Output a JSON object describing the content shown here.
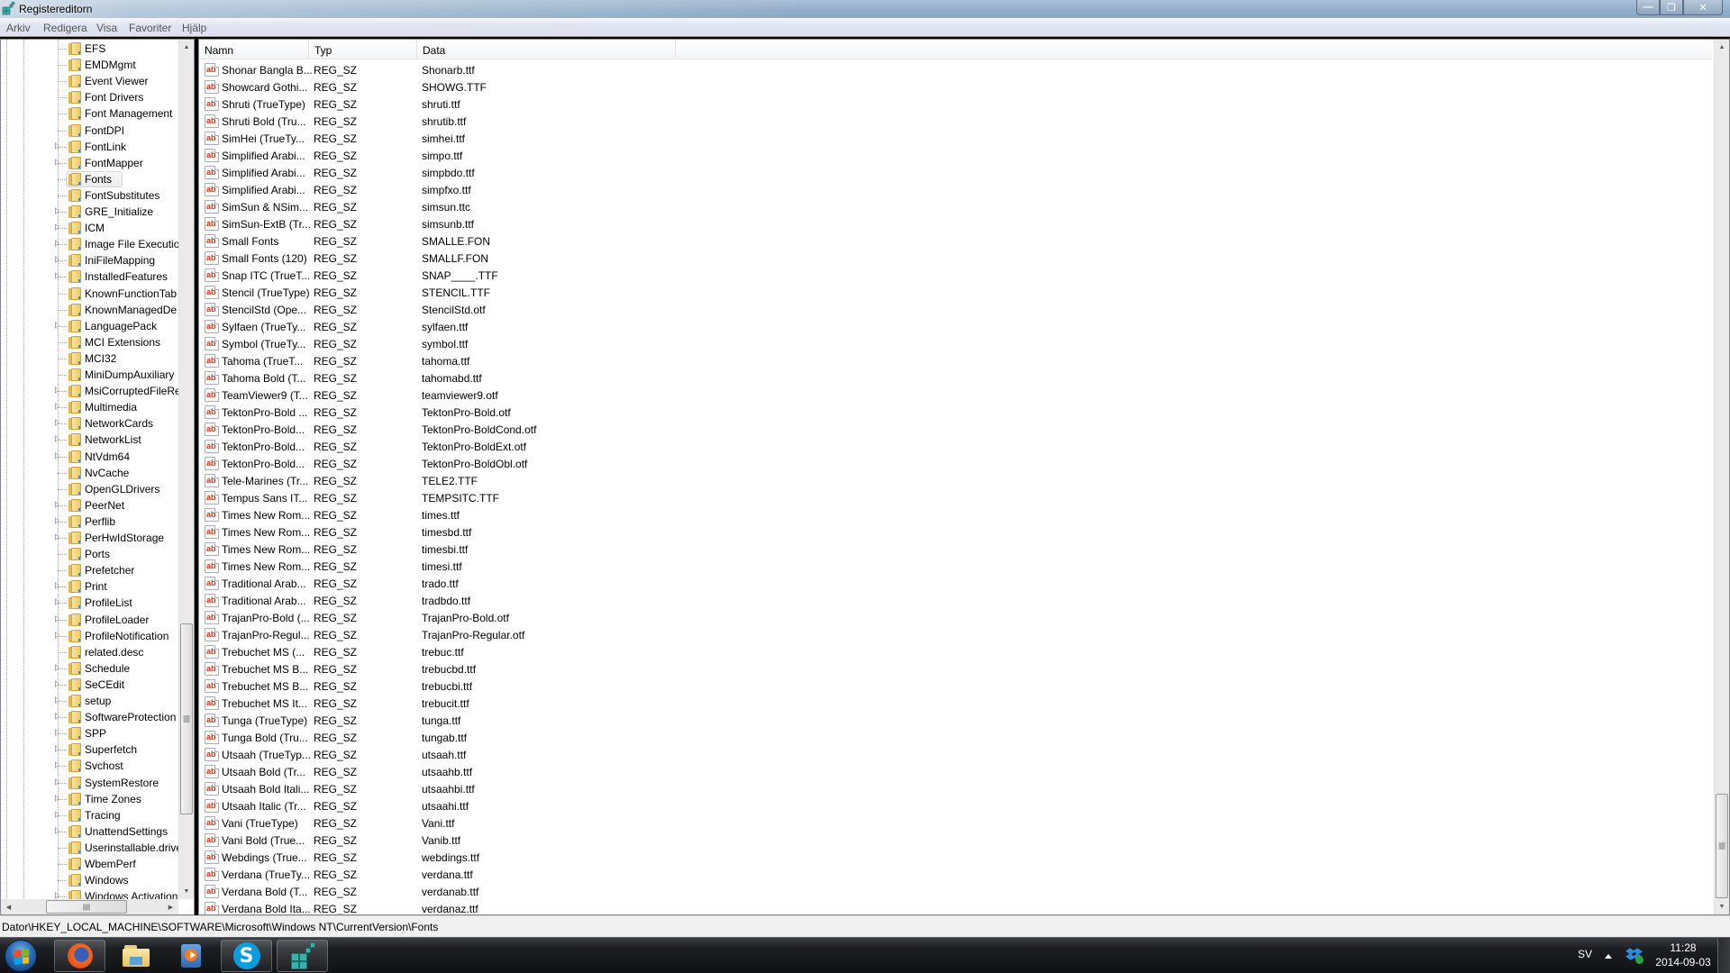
{
  "window": {
    "title": "Registereditorn",
    "controls": {
      "minimize": "—",
      "maximize": "❐",
      "close": "✕"
    }
  },
  "menu": [
    "Arkiv",
    "Redigera",
    "Visa",
    "Favoriter",
    "Hjälp"
  ],
  "tree": {
    "selected": "Fonts",
    "items": [
      {
        "label": "EFS",
        "expandable": false
      },
      {
        "label": "EMDMgmt",
        "expandable": false
      },
      {
        "label": "Event Viewer",
        "expandable": false
      },
      {
        "label": "Font Drivers",
        "expandable": false
      },
      {
        "label": "Font Management",
        "expandable": false
      },
      {
        "label": "FontDPI",
        "expandable": false
      },
      {
        "label": "FontLink",
        "expandable": true
      },
      {
        "label": "FontMapper",
        "expandable": true
      },
      {
        "label": "Fonts",
        "expandable": false
      },
      {
        "label": "FontSubstitutes",
        "expandable": false
      },
      {
        "label": "GRE_Initialize",
        "expandable": true
      },
      {
        "label": "ICM",
        "expandable": true
      },
      {
        "label": "Image File Executio",
        "expandable": true
      },
      {
        "label": "IniFileMapping",
        "expandable": true
      },
      {
        "label": "InstalledFeatures",
        "expandable": true
      },
      {
        "label": "KnownFunctionTab",
        "expandable": false
      },
      {
        "label": "KnownManagedDe",
        "expandable": false
      },
      {
        "label": "LanguagePack",
        "expandable": true
      },
      {
        "label": "MCI Extensions",
        "expandable": false
      },
      {
        "label": "MCI32",
        "expandable": false
      },
      {
        "label": "MiniDumpAuxiliary",
        "expandable": false
      },
      {
        "label": "MsiCorruptedFileRe",
        "expandable": true
      },
      {
        "label": "Multimedia",
        "expandable": true
      },
      {
        "label": "NetworkCards",
        "expandable": true
      },
      {
        "label": "NetworkList",
        "expandable": true
      },
      {
        "label": "NtVdm64",
        "expandable": true
      },
      {
        "label": "NvCache",
        "expandable": false
      },
      {
        "label": "OpenGLDrivers",
        "expandable": false
      },
      {
        "label": "PeerNet",
        "expandable": true
      },
      {
        "label": "Perflib",
        "expandable": true
      },
      {
        "label": "PerHwIdStorage",
        "expandable": true
      },
      {
        "label": "Ports",
        "expandable": false
      },
      {
        "label": "Prefetcher",
        "expandable": false
      },
      {
        "label": "Print",
        "expandable": true
      },
      {
        "label": "ProfileList",
        "expandable": true
      },
      {
        "label": "ProfileLoader",
        "expandable": true
      },
      {
        "label": "ProfileNotification",
        "expandable": true
      },
      {
        "label": "related.desc",
        "expandable": false
      },
      {
        "label": "Schedule",
        "expandable": true
      },
      {
        "label": "SeCEdit",
        "expandable": true
      },
      {
        "label": "setup",
        "expandable": true
      },
      {
        "label": "SoftwareProtection",
        "expandable": true
      },
      {
        "label": "SPP",
        "expandable": true
      },
      {
        "label": "Superfetch",
        "expandable": true
      },
      {
        "label": "Svchost",
        "expandable": true
      },
      {
        "label": "SystemRestore",
        "expandable": true
      },
      {
        "label": "Time Zones",
        "expandable": true
      },
      {
        "label": "Tracing",
        "expandable": true
      },
      {
        "label": "UnattendSettings",
        "expandable": true
      },
      {
        "label": "Userinstallable.drive",
        "expandable": false
      },
      {
        "label": "WbemPerf",
        "expandable": false
      },
      {
        "label": "Windows",
        "expandable": false
      },
      {
        "label": "Windows Activation",
        "expandable": true
      }
    ]
  },
  "list": {
    "columns": [
      "Namn",
      "Typ",
      "Data"
    ],
    "rows": [
      [
        "Shonar Bangla B...",
        "REG_SZ",
        "Shonarb.ttf"
      ],
      [
        "Showcard Gothi...",
        "REG_SZ",
        "SHOWG.TTF"
      ],
      [
        "Shruti (TrueType)",
        "REG_SZ",
        "shruti.ttf"
      ],
      [
        "Shruti Bold (Tru...",
        "REG_SZ",
        "shrutib.ttf"
      ],
      [
        "SimHei (TrueTy...",
        "REG_SZ",
        "simhei.ttf"
      ],
      [
        "Simplified Arabi...",
        "REG_SZ",
        "simpo.ttf"
      ],
      [
        "Simplified Arabi...",
        "REG_SZ",
        "simpbdo.ttf"
      ],
      [
        "Simplified Arabi...",
        "REG_SZ",
        "simpfxo.ttf"
      ],
      [
        "SimSun & NSim...",
        "REG_SZ",
        "simsun.ttc"
      ],
      [
        "SimSun-ExtB (Tr...",
        "REG_SZ",
        "simsunb.ttf"
      ],
      [
        "Small Fonts",
        "REG_SZ",
        "SMALLE.FON"
      ],
      [
        "Small Fonts (120)",
        "REG_SZ",
        "SMALLF.FON"
      ],
      [
        "Snap ITC (TrueT...",
        "REG_SZ",
        "SNAP____.TTF"
      ],
      [
        "Stencil (TrueType)",
        "REG_SZ",
        "STENCIL.TTF"
      ],
      [
        "StencilStd (Ope...",
        "REG_SZ",
        "StencilStd.otf"
      ],
      [
        "Sylfaen (TrueTy...",
        "REG_SZ",
        "sylfaen.ttf"
      ],
      [
        "Symbol (TrueTy...",
        "REG_SZ",
        "symbol.ttf"
      ],
      [
        "Tahoma (TrueT...",
        "REG_SZ",
        "tahoma.ttf"
      ],
      [
        "Tahoma Bold (T...",
        "REG_SZ",
        "tahomabd.ttf"
      ],
      [
        "TeamViewer9 (T...",
        "REG_SZ",
        "teamviewer9.otf"
      ],
      [
        "TektonPro-Bold ...",
        "REG_SZ",
        "TektonPro-Bold.otf"
      ],
      [
        "TektonPro-Bold...",
        "REG_SZ",
        "TektonPro-BoldCond.otf"
      ],
      [
        "TektonPro-Bold...",
        "REG_SZ",
        "TektonPro-BoldExt.otf"
      ],
      [
        "TektonPro-Bold...",
        "REG_SZ",
        "TektonPro-BoldObl.otf"
      ],
      [
        "Tele-Marines (Tr...",
        "REG_SZ",
        "TELE2.TTF"
      ],
      [
        "Tempus Sans IT...",
        "REG_SZ",
        "TEMPSITC.TTF"
      ],
      [
        "Times New Rom...",
        "REG_SZ",
        "times.ttf"
      ],
      [
        "Times New Rom...",
        "REG_SZ",
        "timesbd.ttf"
      ],
      [
        "Times New Rom...",
        "REG_SZ",
        "timesbi.ttf"
      ],
      [
        "Times New Rom...",
        "REG_SZ",
        "timesi.ttf"
      ],
      [
        "Traditional Arab...",
        "REG_SZ",
        "trado.ttf"
      ],
      [
        "Traditional Arab...",
        "REG_SZ",
        "tradbdo.ttf"
      ],
      [
        "TrajanPro-Bold (...",
        "REG_SZ",
        "TrajanPro-Bold.otf"
      ],
      [
        "TrajanPro-Regul...",
        "REG_SZ",
        "TrajanPro-Regular.otf"
      ],
      [
        "Trebuchet MS (...",
        "REG_SZ",
        "trebuc.ttf"
      ],
      [
        "Trebuchet MS B...",
        "REG_SZ",
        "trebucbd.ttf"
      ],
      [
        "Trebuchet MS B...",
        "REG_SZ",
        "trebucbi.ttf"
      ],
      [
        "Trebuchet MS It...",
        "REG_SZ",
        "trebucit.ttf"
      ],
      [
        "Tunga (TrueType)",
        "REG_SZ",
        "tunga.ttf"
      ],
      [
        "Tunga Bold (Tru...",
        "REG_SZ",
        "tungab.ttf"
      ],
      [
        "Utsaah (TrueTyp...",
        "REG_SZ",
        "utsaah.ttf"
      ],
      [
        "Utsaah Bold (Tr...",
        "REG_SZ",
        "utsaahb.ttf"
      ],
      [
        "Utsaah Bold Itali...",
        "REG_SZ",
        "utsaahbi.ttf"
      ],
      [
        "Utsaah Italic (Tr...",
        "REG_SZ",
        "utsaahi.ttf"
      ],
      [
        "Vani (TrueType)",
        "REG_SZ",
        "Vani.ttf"
      ],
      [
        "Vani Bold (True...",
        "REG_SZ",
        "Vanib.ttf"
      ],
      [
        "Webdings (True...",
        "REG_SZ",
        "webdings.ttf"
      ],
      [
        "Verdana (TrueTy...",
        "REG_SZ",
        "verdana.ttf"
      ],
      [
        "Verdana Bold (T...",
        "REG_SZ",
        "verdanab.ttf"
      ],
      [
        "Verdana Bold Ita...",
        "REG_SZ",
        "verdanaz.ttf"
      ]
    ],
    "value_icon": "ab"
  },
  "status_path": "Dator\\HKEY_LOCAL_MACHINE\\SOFTWARE\\Microsoft\\Windows NT\\CurrentVersion\\Fonts",
  "taskbar": {
    "apps": [
      {
        "name": "firefox",
        "active": true
      },
      {
        "name": "file-explorer",
        "active": false
      },
      {
        "name": "media-player",
        "active": false
      },
      {
        "name": "skype",
        "active": true,
        "glyph": "S"
      },
      {
        "name": "registry-editor",
        "active": true
      }
    ],
    "language": "SV",
    "time": "11:28",
    "date": "2014-09-03"
  }
}
